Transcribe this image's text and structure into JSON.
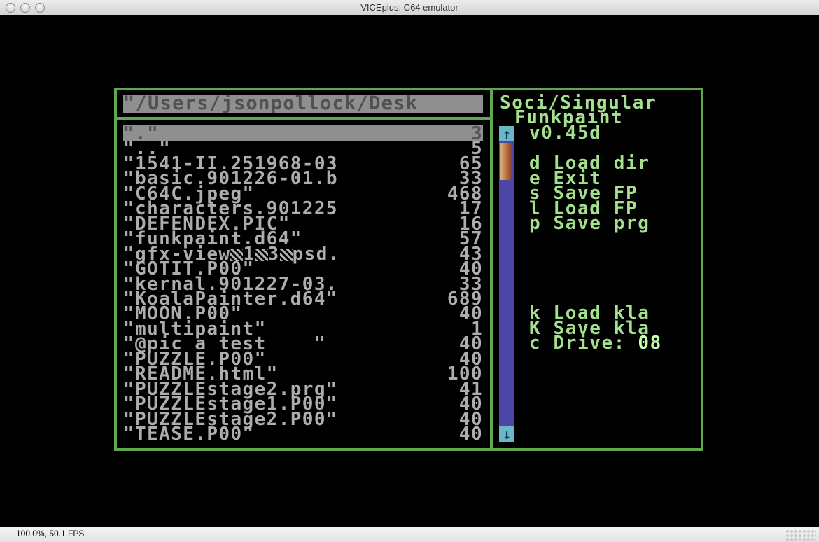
{
  "window": {
    "title": "VICEplus: C64 emulator"
  },
  "status": {
    "text": "100.0%, 50.1 FPS"
  },
  "colors": {
    "border_green": "#5fa84e",
    "text_gray": "#adadad",
    "highlight_gray": "#8f8f8f",
    "menu_green": "#a4e08e",
    "scroll_track": "#4d45a8",
    "scroll_arrow": "#6ab7c9"
  },
  "browser": {
    "path": "\"/Users/jsonpollock/Desk",
    "files": [
      {
        "name": "\".\"",
        "size": "3",
        "selected": true
      },
      {
        "name": "\"..\"",
        "size": "5"
      },
      {
        "name": "\"1541-II.251968-03",
        "size": "65"
      },
      {
        "name": "\"basic.901226-01.b",
        "size": "33"
      },
      {
        "name": "\"C64C.jpeg\"",
        "size": "468"
      },
      {
        "name": "\"characters.901225",
        "size": "17"
      },
      {
        "name": "\"DEFENDEX.PIC\"",
        "size": "16"
      },
      {
        "name": "\"funkpaint.d64\"",
        "size": "57"
      },
      {
        "name": "\"gfx-view",
        "name_parts": [
          "1",
          "3",
          "psd."
        ],
        "size": "43"
      },
      {
        "name": "\"GOTIT.P00\"",
        "size": "40"
      },
      {
        "name": "\"kernal.901227-03.",
        "size": "33"
      },
      {
        "name": "\"KoalaPainter.d64\"",
        "size": "689"
      },
      {
        "name": "\"MOON.P00\"",
        "size": "40"
      },
      {
        "name": "\"multipaint\"",
        "size": "1"
      },
      {
        "name": "\"@pic a test    \"",
        "size": "40"
      },
      {
        "name": "\"PUZZLE.P00\"",
        "size": "40"
      },
      {
        "name": "\"README.html\"",
        "size": "100"
      },
      {
        "name": "\"PUZZLEstage2.prg\"",
        "size": "41"
      },
      {
        "name": "\"PUZZLEstage1.P00\"",
        "size": "40"
      },
      {
        "name": "\"PUZZLEstage2.P00\"",
        "size": "40"
      },
      {
        "name": "\"TEASE.P00\"",
        "size": "40"
      }
    ],
    "scroll_position": 0.0,
    "scroll_up_icon": "arrow-up-icon",
    "scroll_down_icon": "arrow-down-icon"
  },
  "menu": {
    "credit": "Soci/Singular",
    "app_name": "Funkpaint",
    "version": "v0.45d",
    "commands": [
      {
        "key": "d",
        "label": "Load dir"
      },
      {
        "key": "e",
        "label": "Exit"
      },
      {
        "key": "s",
        "label": "Save FP"
      },
      {
        "key": "l",
        "label": "Load FP"
      },
      {
        "key": "p",
        "label": "Save prg"
      }
    ],
    "commands2": [
      {
        "key": "k",
        "label": "Load kla"
      },
      {
        "key": "K",
        "label": "Save kla"
      },
      {
        "key": "c",
        "label": "Drive:",
        "value": "08"
      }
    ]
  }
}
